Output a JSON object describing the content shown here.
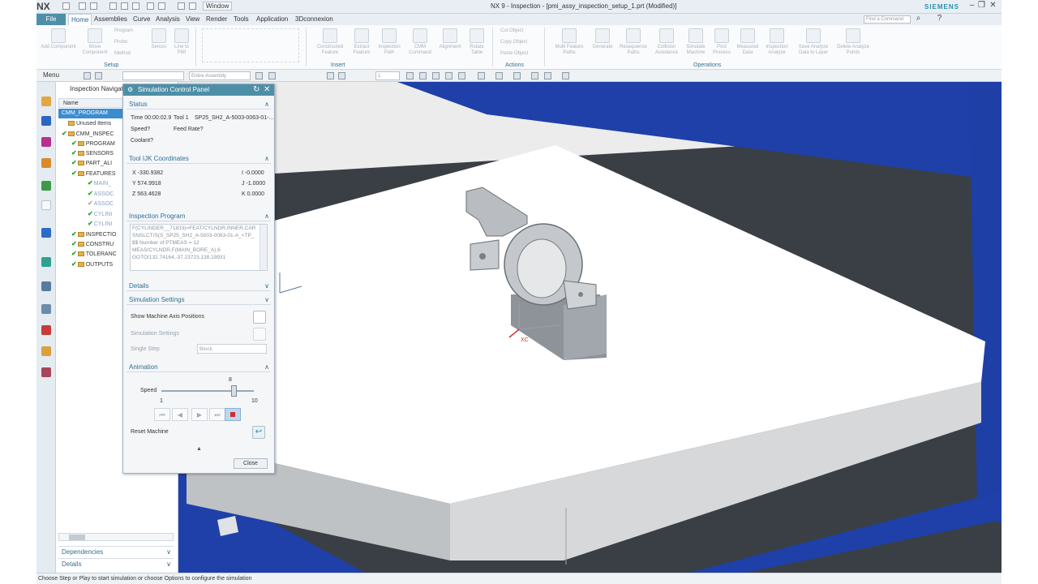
{
  "app": {
    "logo": "NX",
    "window_menu": "Window",
    "title": "NX 9 - Inspection - [pmi_assy_inspection_setup_1.prt (Modified)]",
    "brand": "SIEMENS",
    "find_command_placeholder": "Find a Command"
  },
  "menu_tabs": [
    "File",
    "Home",
    "Assemblies",
    "Curve",
    "Analysis",
    "View",
    "Render",
    "Tools",
    "Application",
    "3Dconnexion"
  ],
  "active_tab": "Home",
  "ribbon": {
    "setup": {
      "label": "Setup",
      "buttons": [
        "Add Component",
        "Move Component",
        "Sensor",
        "Line to PMI"
      ],
      "small": [
        "Program",
        "Probe",
        "Method"
      ]
    },
    "insert": {
      "label": "Insert",
      "buttons": [
        "Constructed Feature",
        "Extract Feature",
        "Inspection Path",
        "CMM Command",
        "Alignment",
        "Rotate Table"
      ]
    },
    "actions": {
      "label": "Actions",
      "small": [
        "Cut Object",
        "Copy Object",
        "Paste Object"
      ]
    },
    "operations": {
      "label": "Operations",
      "buttons": [
        "Multi Feature Paths",
        "Generate",
        "Resequence Paths",
        "Collision Avoidance",
        "Simulate Machine",
        "Post Process",
        "Measured Data",
        "Inspection Analyze",
        "Save Analyze Data to Layer",
        "Delete Analyze Points"
      ]
    }
  },
  "toolbar": {
    "menu_label": "Menu",
    "assembly_select": "Entire Assembly",
    "layer_select": "1"
  },
  "navigator": {
    "title": "Inspection Navigator",
    "column_header": "Name",
    "items": [
      {
        "label": "CMM_PROGRAM"
      },
      {
        "label": "Unused Items"
      },
      {
        "label": "CMM_INSPEC"
      },
      {
        "label": "PROGRAM"
      },
      {
        "label": "SENSORS"
      },
      {
        "label": "PART_ALI"
      },
      {
        "label": "FEATURES"
      },
      {
        "label": "MAIN_"
      },
      {
        "label": "ASSOC"
      },
      {
        "label": "ASSOC"
      },
      {
        "label": "CYLINI"
      },
      {
        "label": "CYLINI"
      },
      {
        "label": "INSPECTIO"
      },
      {
        "label": "CONSTRU"
      },
      {
        "label": "TOLERANC"
      },
      {
        "label": "OUTPUTS"
      }
    ],
    "sections": [
      "Dependencies",
      "Details"
    ]
  },
  "panel": {
    "title": "Simulation Control Panel",
    "status": {
      "header": "Status",
      "time_label": "Time 00:00:02.9",
      "tool_label": "Tool 1",
      "tool_value": "SP25_SH2_A-5003-0063-01-...",
      "speed_label": "Speed?",
      "feed_label": "Feed Rate?",
      "coolant_label": "Coolant?"
    },
    "coords": {
      "header": "Tool IJK Coordinates",
      "x": "X -330.9382",
      "y": "Y 574.9918",
      "z": "Z 563.4628",
      "i": "I -0.0000",
      "j": "J -1.0000",
      "k": "K 0.0000"
    },
    "program": {
      "header": "Inspection Program",
      "lines": [
        "F(CYLINDER__71833)=FEAT/CYLNDR,INNER,CAR",
        "SNSLCT/S(S_SP25_SH2_A-5003-0063-01-A_<TP_",
        "$$ Number of PTMEAS = 12",
        "MEAS/CYLNDR,F(MAIN_BORE_A),6",
        "GOTO/132.74164,-37.23723,138.19931"
      ]
    },
    "details_header": "Details",
    "sim_settings": {
      "header": "Simulation Settings",
      "show_axis": "Show Machine Axis Positions",
      "settings_label": "Simulation Settings",
      "single_step_label": "Single Step",
      "single_step_value": "Block"
    },
    "animation": {
      "header": "Animation",
      "speed_label": "Speed",
      "speed_value": "8",
      "speed_min": "1",
      "speed_max": "10",
      "speed_fraction": 0.78,
      "reset_label": "Reset Machine"
    },
    "close_label": "Close"
  },
  "viewport": {
    "axis_label": "XC"
  },
  "status_bar": "Choose Step or Play to start simulation or choose Options to configure the simulation",
  "colors": {
    "accent": "#4e8fa8",
    "machine_blue": "#1e40a8",
    "table_white": "#ffffff"
  }
}
